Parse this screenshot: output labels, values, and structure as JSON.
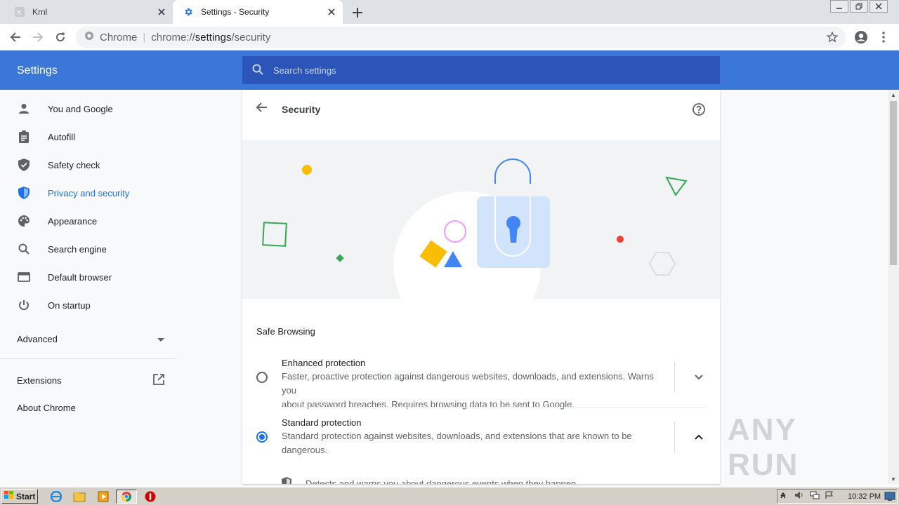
{
  "tabs": [
    {
      "title": "Krnl",
      "icon": "krnl-icon"
    },
    {
      "title": "Settings - Security",
      "icon": "gear-icon"
    }
  ],
  "omnibox": {
    "site_label": "Chrome",
    "url_prefix": "chrome://",
    "url_host": "settings",
    "url_path": "/security"
  },
  "header": {
    "title": "Settings",
    "search_placeholder": "Search settings"
  },
  "sidebar": {
    "items": [
      {
        "label": "You and Google",
        "icon": "person-icon"
      },
      {
        "label": "Autofill",
        "icon": "clipboard-icon"
      },
      {
        "label": "Safety check",
        "icon": "shield-check-icon"
      },
      {
        "label": "Privacy and security",
        "icon": "shield-icon",
        "selected": true
      },
      {
        "label": "Appearance",
        "icon": "palette-icon"
      },
      {
        "label": "Search engine",
        "icon": "search-icon"
      },
      {
        "label": "Default browser",
        "icon": "browser-icon"
      },
      {
        "label": "On startup",
        "icon": "power-icon"
      }
    ],
    "advanced_label": "Advanced",
    "extensions_label": "Extensions",
    "about_label": "About Chrome"
  },
  "page": {
    "title": "Security",
    "section_title": "Safe Browsing",
    "options": [
      {
        "title": "Enhanced protection",
        "desc_line1": "Faster, proactive protection against dangerous websites, downloads, and extensions. Warns you",
        "desc_line2": "about password breaches. Requires browsing data to be sent to Google.",
        "selected": false
      },
      {
        "title": "Standard protection",
        "desc_line1": "Standard protection against websites, downloads, and extensions that are known to be",
        "desc_line2": "dangerous.",
        "selected": true
      }
    ],
    "sub_item": "Detects and warns you about dangerous events when they happen"
  },
  "watermark": "ANY RUN",
  "taskbar": {
    "start_label": "Start",
    "clock": "10:32 PM"
  },
  "colors": {
    "header_blue": "#3b76d9",
    "search_blue": "#2b55b8",
    "accent": "#1a73e8"
  }
}
